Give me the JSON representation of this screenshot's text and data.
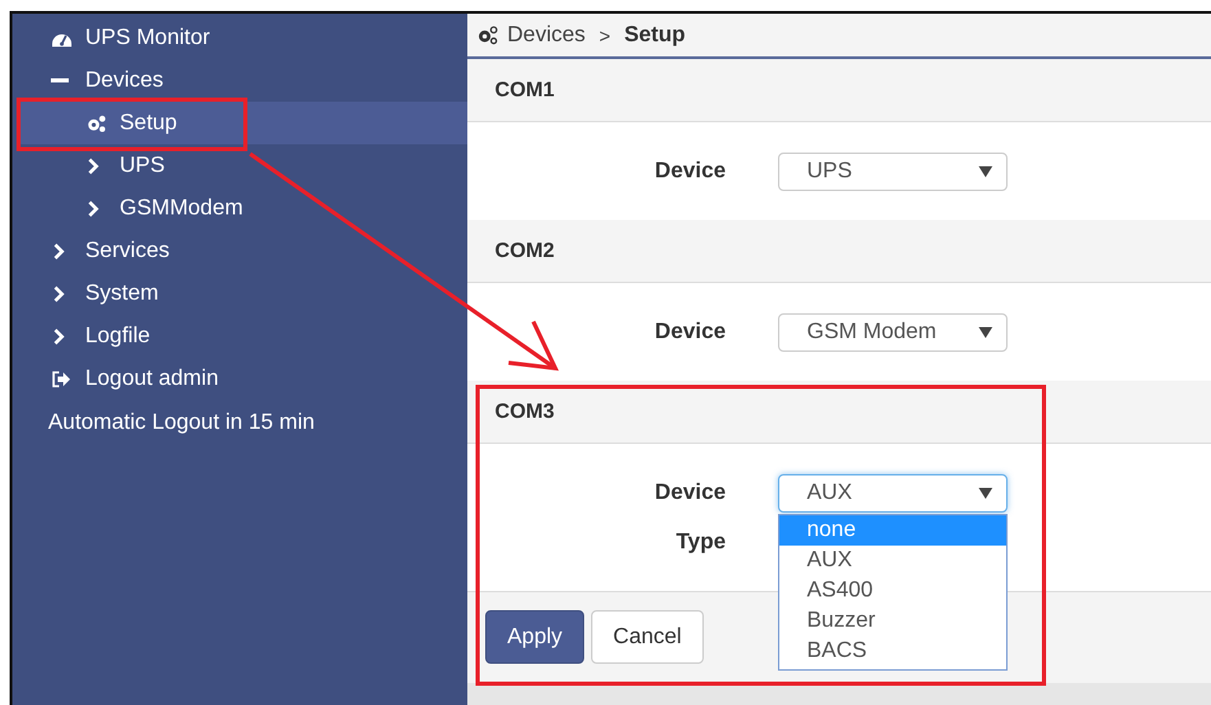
{
  "sidebar": {
    "items": [
      {
        "label": "UPS Monitor",
        "kind": "dashboard",
        "selected": false
      },
      {
        "label": "Devices",
        "kind": "group",
        "expanded": true,
        "selected": false,
        "children": [
          {
            "label": "Setup",
            "kind": "page",
            "selected": true
          },
          {
            "label": "UPS",
            "kind": "group",
            "expanded": false,
            "selected": false
          },
          {
            "label": "GSMModem",
            "kind": "group",
            "expanded": false,
            "selected": false
          }
        ]
      },
      {
        "label": "Services",
        "kind": "group",
        "expanded": false,
        "selected": false
      },
      {
        "label": "System",
        "kind": "group",
        "expanded": false,
        "selected": false
      },
      {
        "label": "Logfile",
        "kind": "group",
        "expanded": false,
        "selected": false
      },
      {
        "label": "Logout admin",
        "kind": "logout",
        "selected": false
      }
    ],
    "note": "Automatic Logout in 15 min"
  },
  "breadcrumb": {
    "items": [
      "Devices",
      "Setup"
    ],
    "separator": ">"
  },
  "sections": [
    {
      "title": "COM1",
      "fields": [
        {
          "label": "Device",
          "value": "UPS",
          "focused": false
        }
      ]
    },
    {
      "title": "COM2",
      "fields": [
        {
          "label": "Device",
          "value": "GSM Modem",
          "focused": false
        }
      ]
    },
    {
      "title": "COM3",
      "fields": [
        {
          "label": "Device",
          "value": "AUX",
          "focused": true,
          "options": [
            {
              "label": "none",
              "highlighted": true
            },
            {
              "label": "AUX",
              "highlighted": false
            },
            {
              "label": "AS400",
              "highlighted": false
            },
            {
              "label": "Buzzer",
              "highlighted": false
            },
            {
              "label": "BACS",
              "highlighted": false
            }
          ]
        },
        {
          "label": "Type"
        }
      ]
    }
  ],
  "buttons": [
    {
      "label": "Apply",
      "kind": "primary"
    },
    {
      "label": "Cancel",
      "kind": "default"
    }
  ]
}
